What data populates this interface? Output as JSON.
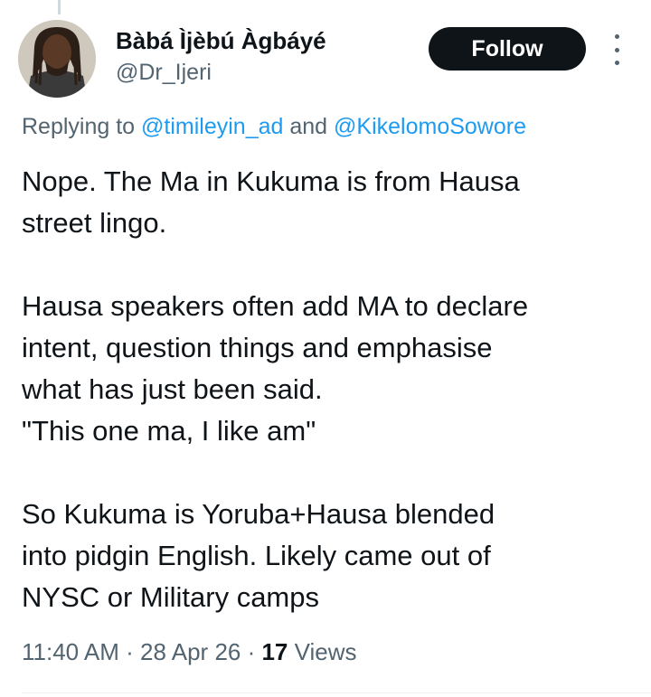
{
  "author": {
    "display_name": "Bàbá Ìjèbú Àgbáyé",
    "handle": "@Dr_Ijeri"
  },
  "actions": {
    "follow_label": "Follow",
    "more_icon": "more-vertical-icon"
  },
  "reply_context": {
    "prefix": "Replying to ",
    "mention_1": "@timileyin_ad",
    "conjunction": " and ",
    "mention_2": "@KikelomoSowore"
  },
  "tweet": {
    "lines": [
      "Nope. The Ma in Kukuma is from Hausa",
      "street lingo.",
      "",
      "Hausa speakers often add MA to declare",
      "intent, question things and emphasise",
      "what has just been said.",
      "\"This one ma, I like am\"",
      "",
      "So Kukuma is Yoruba+Hausa blended",
      "into pidgin English. Likely came out of",
      "NYSC or Military camps"
    ]
  },
  "meta": {
    "time": "11:40 AM",
    "separator": " · ",
    "date": "28 Apr 26",
    "views_count": "17",
    "views_label": " Views"
  },
  "colors": {
    "text": "#0f1419",
    "secondary": "#536471",
    "link": "#1d9bf0",
    "button_bg": "#0f1419"
  }
}
